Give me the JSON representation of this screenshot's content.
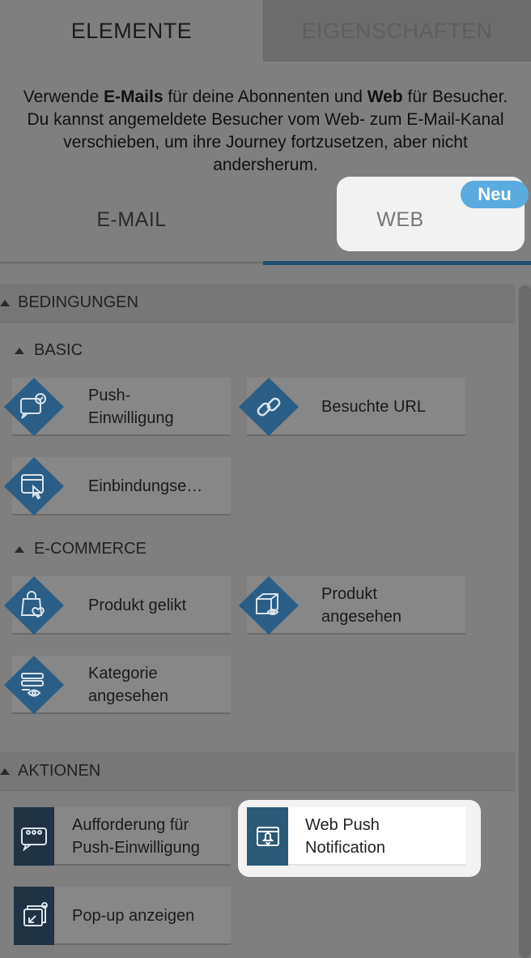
{
  "tabs": {
    "elements": "ELEMENTE",
    "properties": "EIGENSCHAFTEN"
  },
  "intro": {
    "part1": "Verwende ",
    "bold1": "E-Mails",
    "part2": " für deine Abonnenten und ",
    "bold2": "Web",
    "part3": " für Besucher. Du kannst angemeldete Besucher vom Web- zum E-Mail-Kanal verschieben, um ihre Journey fortzusetzen, aber nicht andersherum."
  },
  "channels": {
    "email": "E-MAIL",
    "web": "WEB",
    "badge": "Neu"
  },
  "conditions": {
    "title": "BEDINGUNGEN",
    "basic": {
      "title": "BASIC",
      "items": [
        "Push-\nEinwilligung",
        "Besuchte URL",
        "Einbindungse…"
      ]
    },
    "ecommerce": {
      "title": "E-COMMERCE",
      "items": [
        "Produkt gelikt",
        "Produkt\nangesehen",
        "Kategorie\nangesehen"
      ]
    }
  },
  "actions": {
    "title": "AKTIONEN",
    "items": [
      "Aufforderung für\nPush-Einwilligung",
      "Web Push\nNotification",
      "Pop-up anzeigen"
    ]
  },
  "colors": {
    "diamond": "#2a5e86",
    "action_icon": "#1f3344",
    "highlight": "#f2f2f2",
    "badge": "#5aabdf",
    "underline": "#1f4e6e"
  }
}
